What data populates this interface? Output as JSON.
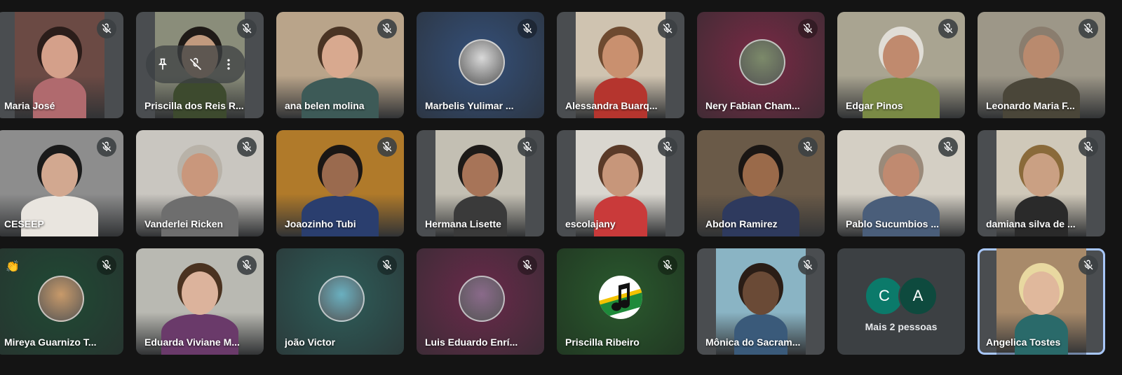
{
  "participants": [
    {
      "name": "Maria José",
      "mode": "video",
      "narrow": true,
      "bg": "#6b4a44",
      "skin": "#d4a08a",
      "shirt": "#b06a6e",
      "hair": "#2b1d1a"
    },
    {
      "name": "Priscilla dos Reis R...",
      "mode": "video",
      "narrow": true,
      "bg": "#8a8d7a",
      "skin": "#c19a7e",
      "shirt": "#3d4a2e",
      "hair": "#1f1a17",
      "controls": true
    },
    {
      "name": "ana belen molina",
      "mode": "video",
      "bg": "#b9a48a",
      "skin": "#d8a98f",
      "shirt": "#3d5a57",
      "hair": "#4a3424"
    },
    {
      "name": "Marbelis Yulimar ...",
      "mode": "avatar",
      "bg": "#34507a",
      "avatarColor": "#d9d9d9",
      "micActive": true
    },
    {
      "name": "Alessandra Buarq...",
      "mode": "video",
      "narrow": true,
      "bg": "#cfc3b0",
      "skin": "#c9906f",
      "shirt": "#b5352e",
      "hair": "#6e4a30"
    },
    {
      "name": "Nery Fabian Cham...",
      "mode": "avatar",
      "bg": "#7a2a45",
      "avatarColor": "#7c8a6a",
      "micActive": true
    },
    {
      "name": "Edgar Pinos",
      "mode": "video",
      "bg": "#a9a491",
      "skin": "#c08a6e",
      "shirt": "#7a8a45",
      "hair": "#e0ddd6"
    },
    {
      "name": "Leonardo Maria F...",
      "mode": "video",
      "bg": "#9d9788",
      "skin": "#b98a6e",
      "shirt": "#4a4639",
      "hair": "#8a7d6e"
    },
    {
      "name": "CESEEP",
      "mode": "video",
      "bg": "#8d8d8d",
      "skin": "#d2a890",
      "shirt": "#e9e5df",
      "hair": "#1a1a1a"
    },
    {
      "name": "Vanderlei Ricken",
      "mode": "video",
      "bg": "#c9c6c0",
      "skin": "#c9977c",
      "shirt": "#6e6e6e",
      "hair": "#b8b2a8"
    },
    {
      "name": "Joaozinho Tubi",
      "mode": "video",
      "bg": "#b07a2a",
      "skin": "#9a6a4e",
      "shirt": "#2a3e6e",
      "hair": "#1a1614"
    },
    {
      "name": "Hermana Lisette",
      "mode": "video",
      "narrow": true,
      "bg": "#c3bfb3",
      "skin": "#a77458",
      "shirt": "#3a3a3a",
      "hair": "#1d1a18"
    },
    {
      "name": "escolajany",
      "mode": "video",
      "narrow": true,
      "bg": "#d9d6cf",
      "skin": "#c7967a",
      "shirt": "#c93a3a",
      "hair": "#5a3a28"
    },
    {
      "name": "Abdon Ramirez",
      "mode": "video",
      "bg": "#6a5a48",
      "skin": "#9a6a4a",
      "shirt": "#2e3a5e",
      "hair": "#1a1614"
    },
    {
      "name": "Pablo Sucumbios ...",
      "mode": "video",
      "bg": "#d4cfc4",
      "skin": "#c08a70",
      "shirt": "#4a5e7a",
      "hair": "#9a8a7a"
    },
    {
      "name": "damiana silva de ...",
      "mode": "video",
      "narrow": true,
      "bg": "#cfc8b9",
      "skin": "#caa083",
      "shirt": "#2a2a2a",
      "hair": "#8a6a3a"
    },
    {
      "name": "Mireya Guarnizo T...",
      "mode": "avatar",
      "bg": "#1f4a34",
      "avatarColor": "#c89a6a",
      "micActive": true,
      "reaction": "👏"
    },
    {
      "name": "Eduarda Viviane M...",
      "mode": "video",
      "bg": "#b9b9b2",
      "skin": "#dcb39c",
      "shirt": "#6a3a6a",
      "hair": "#4a3220"
    },
    {
      "name": "joão Victor",
      "mode": "avatar",
      "bg": "#2e5e5a",
      "avatarColor": "#6ab0c0",
      "micActive": true
    },
    {
      "name": "Luis Eduardo Enrí...",
      "mode": "avatar",
      "bg": "#6a2a4a",
      "avatarColor": "#8a6a8a",
      "micActive": true
    },
    {
      "name": "Priscilla Ribeiro",
      "mode": "music",
      "bg": "#2a5a2e",
      "micActive": true
    },
    {
      "name": "Mônica do Sacram...",
      "mode": "video",
      "narrow": true,
      "bg": "#8ab4c4",
      "skin": "#6a4a36",
      "shirt": "#3a5a7a",
      "hair": "#2a1d16"
    },
    {
      "name": "",
      "mode": "more",
      "moreLabel": "Mais 2 pessoas",
      "initials": [
        "C",
        "A"
      ],
      "initialColors": [
        "#0b7a6a",
        "#0e4a3e"
      ]
    },
    {
      "name": "Angelica Tostes",
      "mode": "video",
      "active": true,
      "narrow": true,
      "bg": "#a88a6a",
      "skin": "#e0b89c",
      "shirt": "#2a6a6a",
      "hair": "#e8d8a0"
    }
  ],
  "colors": {
    "background": "#141414",
    "tile": "#3c4043",
    "activeBorder": "#a8c7fa",
    "micBadge": "#3c4043",
    "micActiveBlue": "#0b3d91"
  },
  "icons": {
    "mic": "mic-off-icon",
    "pin": "pin-icon",
    "more": "more-vert-icon"
  }
}
